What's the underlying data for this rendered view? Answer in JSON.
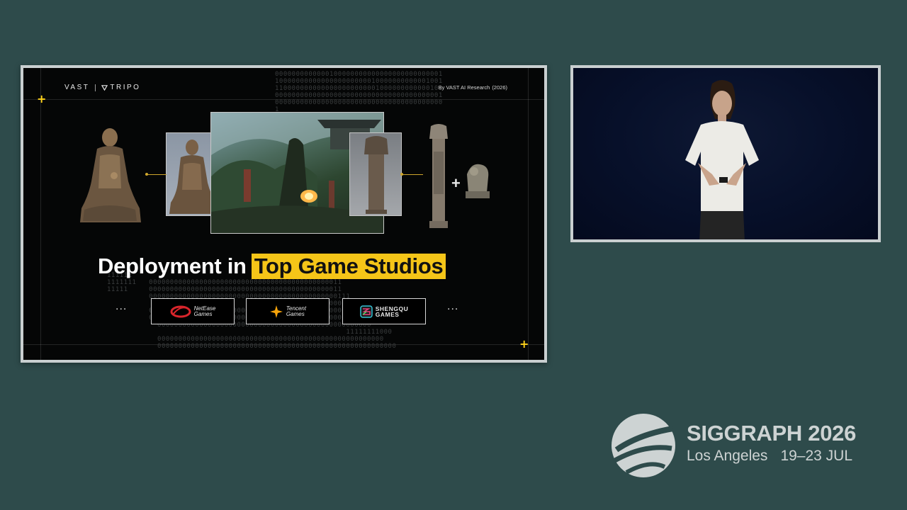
{
  "slide": {
    "brand_left": "VAST",
    "brand_right": "TRIPO",
    "byline": "By VAST AI Research",
    "byline_year": "(2026)",
    "headline_prefix": "Deployment in",
    "headline_highlight": "Top Game Studios",
    "ellipsis_left": "...",
    "ellipsis_right": "...",
    "studios": [
      {
        "name": "NetEase Games",
        "line1": "NetEase",
        "line2": "Games",
        "icon": "netease-icon"
      },
      {
        "name": "Tencent Games",
        "line1": "Tencent",
        "line2": "Games",
        "icon": "tencent-icon"
      },
      {
        "name": "SHENGQU GAMES",
        "line1": "SHENGQU",
        "line2": "GAMES",
        "icon": "shengqu-icon"
      }
    ],
    "accent_color": "#f5c518",
    "plus_sign": "+"
  },
  "event": {
    "name": "SIGGRAPH 2026",
    "city": "Los Angeles",
    "dates": "19–23 JUL"
  },
  "colors": {
    "background": "#2e4b4b",
    "branding": "#cdd3d3"
  }
}
